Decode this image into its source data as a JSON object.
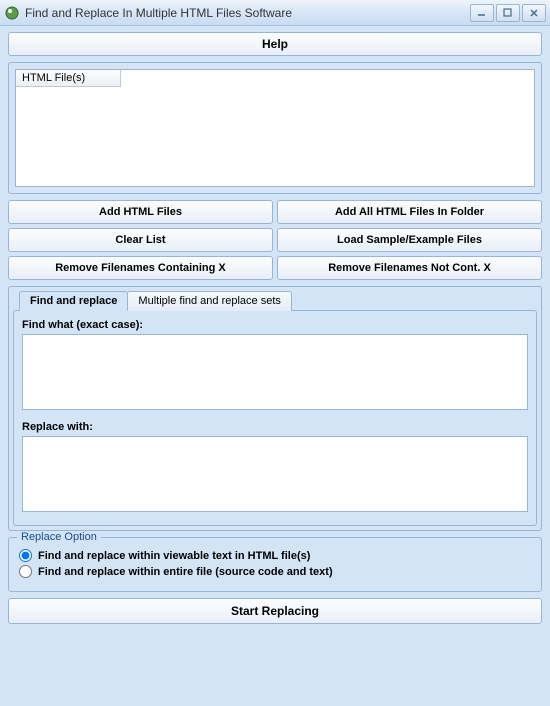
{
  "window": {
    "title": "Find and Replace In Multiple HTML Files Software"
  },
  "help_label": "Help",
  "file_list": {
    "header": "HTML File(s)"
  },
  "buttons": {
    "add_files": "Add HTML Files",
    "add_folder": "Add All HTML Files In Folder",
    "clear_list": "Clear List",
    "load_sample": "Load Sample/Example Files",
    "remove_containing": "Remove Filenames Containing X",
    "remove_not_containing": "Remove Filenames Not Cont. X"
  },
  "tabs": {
    "find_replace": "Find and replace",
    "multiple_sets": "Multiple find and replace sets"
  },
  "find_replace_panel": {
    "find_label": "Find what (exact case):",
    "find_value": "",
    "replace_label": "Replace with:",
    "replace_value": ""
  },
  "replace_option": {
    "legend": "Replace Option",
    "opt_viewable": "Find and replace within viewable text in HTML file(s)",
    "opt_entire": "Find and replace within entire file (source code and text)",
    "selected": "viewable"
  },
  "start_label": "Start Replacing"
}
